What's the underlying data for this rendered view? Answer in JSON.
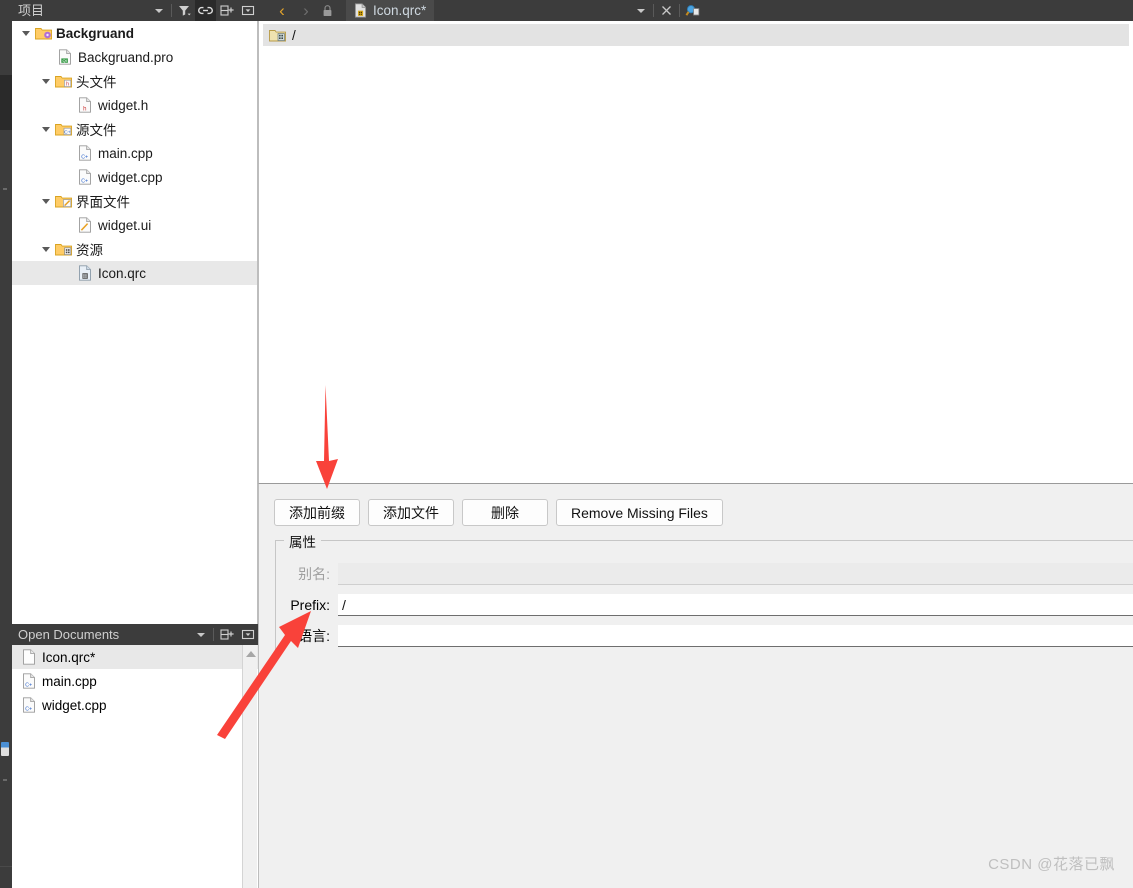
{
  "window": {
    "accent_red": "#f9423a",
    "dark_chrome": "#3c3c3c"
  },
  "projects_dock": {
    "title": "项目",
    "tools": [
      {
        "name": "filter-dropdown-icon",
        "glyph": "▾"
      },
      {
        "name": "filter-icon",
        "glyph": "filter"
      },
      {
        "name": "link-icon",
        "glyph": "link"
      },
      {
        "name": "split-add-icon",
        "glyph": "splitadd"
      },
      {
        "name": "close-dock-icon",
        "glyph": "closebox"
      }
    ]
  },
  "nav_buttons": {
    "back": "‹",
    "forward": "›",
    "lock": "lock-icon"
  },
  "tree": [
    {
      "label": "Backgruand",
      "indent": 0,
      "icon": "project-folder",
      "expander": "open",
      "bold": true,
      "selected": false
    },
    {
      "label": "Backgruand.pro",
      "indent": 1,
      "icon": "pro-file",
      "expander": "none",
      "bold": false,
      "selected": false
    },
    {
      "label": "头文件",
      "indent": 1,
      "icon": "folder-h",
      "expander": "open",
      "bold": false,
      "selected": false
    },
    {
      "label": "widget.h",
      "indent": 2,
      "icon": "h-file",
      "expander": "none",
      "bold": false,
      "selected": false
    },
    {
      "label": "源文件",
      "indent": 1,
      "icon": "folder-cpp",
      "expander": "open",
      "bold": false,
      "selected": false
    },
    {
      "label": "main.cpp",
      "indent": 2,
      "icon": "cpp-file",
      "expander": "none",
      "bold": false,
      "selected": false
    },
    {
      "label": "widget.cpp",
      "indent": 2,
      "icon": "cpp-file",
      "expander": "none",
      "bold": false,
      "selected": false
    },
    {
      "label": "界面文件",
      "indent": 1,
      "icon": "folder-ui",
      "expander": "open",
      "bold": false,
      "selected": false
    },
    {
      "label": "widget.ui",
      "indent": 2,
      "icon": "ui-file",
      "expander": "none",
      "bold": false,
      "selected": false
    },
    {
      "label": "资源",
      "indent": 1,
      "icon": "folder-qrc",
      "expander": "open",
      "bold": false,
      "selected": false
    },
    {
      "label": "Icon.qrc",
      "indent": 2,
      "icon": "qrc-file",
      "expander": "none",
      "bold": false,
      "selected": true
    }
  ],
  "open_documents": {
    "title": "Open Documents",
    "tools": [
      {
        "name": "dropdown-icon",
        "glyph": "▾"
      },
      {
        "name": "split-add-icon",
        "glyph": "splitadd"
      },
      {
        "name": "close-dock-icon",
        "glyph": "closebox"
      }
    ],
    "items": [
      {
        "label": "Icon.qrc*",
        "icon": "plain-file",
        "selected": true
      },
      {
        "label": "main.cpp",
        "icon": "cpp-file",
        "selected": false
      },
      {
        "label": "widget.cpp",
        "icon": "cpp-file",
        "selected": false
      }
    ]
  },
  "editor_tab": {
    "label": "Icon.qrc*",
    "icon": "qrc-file",
    "dropdown": "▾",
    "close": "✕",
    "split_icon": "split-editor-icon"
  },
  "resource_tree": {
    "rows": [
      {
        "label": "/",
        "icon": "prefix-folder-icon",
        "selected": true
      }
    ]
  },
  "resource_buttons": [
    {
      "name": "add-prefix-button",
      "label": "添加前缀"
    },
    {
      "name": "add-files-button",
      "label": "添加文件"
    },
    {
      "name": "remove-button",
      "label": "删除"
    },
    {
      "name": "remove-missing-files-button",
      "label": "Remove Missing Files"
    }
  ],
  "properties": {
    "title": "属性",
    "fields": [
      {
        "name": "alias",
        "label": "别名:",
        "value": "",
        "disabled": true
      },
      {
        "name": "prefix",
        "label": "Prefix:",
        "value": "/",
        "disabled": false
      },
      {
        "name": "language",
        "label": "语言:",
        "value": "",
        "disabled": false
      }
    ]
  },
  "annotations": [
    {
      "name": "arrow-to-add-prefix-button",
      "color": "#f9423a"
    },
    {
      "name": "arrow-to-prefix-field",
      "color": "#f9423a"
    }
  ],
  "watermark": "CSDN @花落已飘"
}
